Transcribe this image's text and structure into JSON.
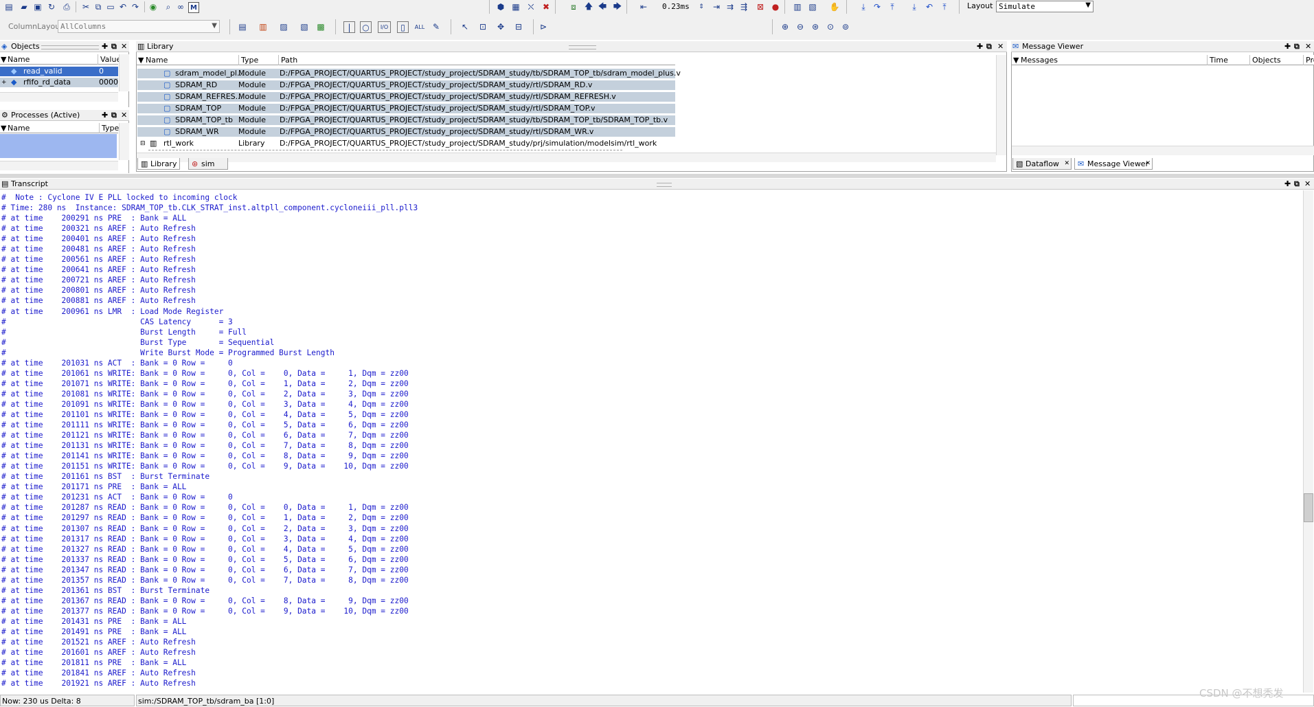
{
  "toolbar": {
    "time_value": "0.23ms",
    "layout_label": "Layout",
    "layout_value": "Simulate",
    "column_layout_label": "ColumnLayout",
    "column_layout_value": "AllColumns"
  },
  "objects": {
    "title": "Objects",
    "col_name": "Name",
    "col_value": "Value",
    "rows": [
      {
        "name": "read_valid",
        "value": "0"
      },
      {
        "name": "rfifo_rd_data",
        "value": "0000("
      }
    ]
  },
  "processes": {
    "title": "Processes (Active)",
    "col_name": "Name",
    "col_type": "Type"
  },
  "library": {
    "title": "Library",
    "col_name": "Name",
    "col_type": "Type",
    "col_path": "Path",
    "rows": [
      {
        "name": "sdram_model_pl...",
        "type": "Module",
        "path": "D:/FPGA_PROJECT/QUARTUS_PROJECT/study_project/SDRAM_study/tb/SDRAM_TOP_tb/sdram_model_plus.v"
      },
      {
        "name": "SDRAM_RD",
        "type": "Module",
        "path": "D:/FPGA_PROJECT/QUARTUS_PROJECT/study_project/SDRAM_study/rtl/SDRAM_RD.v"
      },
      {
        "name": "SDRAM_REFRES...",
        "type": "Module",
        "path": "D:/FPGA_PROJECT/QUARTUS_PROJECT/study_project/SDRAM_study/rtl/SDRAM_REFRESH.v"
      },
      {
        "name": "SDRAM_TOP",
        "type": "Module",
        "path": "D:/FPGA_PROJECT/QUARTUS_PROJECT/study_project/SDRAM_study/rtl/SDRAM_TOP.v"
      },
      {
        "name": "SDRAM_TOP_tb",
        "type": "Module",
        "path": "D:/FPGA_PROJECT/QUARTUS_PROJECT/study_project/SDRAM_study/tb/SDRAM_TOP_tb/SDRAM_TOP_tb.v"
      },
      {
        "name": "SDRAM_WR",
        "type": "Module",
        "path": "D:/FPGA_PROJECT/QUARTUS_PROJECT/study_project/SDRAM_study/rtl/SDRAM_WR.v"
      },
      {
        "name": "rtl_work",
        "type": "Library",
        "path": "D:/FPGA_PROJECT/QUARTUS_PROJECT/study_project/SDRAM_study/prj/simulation/modelsim/rtl_work"
      }
    ],
    "tabs": [
      "Library",
      "sim"
    ]
  },
  "messages": {
    "title": "Message Viewer",
    "col_messages": "Messages",
    "col_time": "Time",
    "col_objects": "Objects",
    "col_pro": "Pro",
    "tabs": [
      "Dataflow",
      "Message Viewer"
    ]
  },
  "transcript": {
    "title": "Transcript",
    "lines": [
      "#  Note : Cyclone IV E PLL locked to incoming clock",
      "# Time: 280 ns  Instance: SDRAM_TOP_tb.CLK_STRAT_inst.altpll_component.cycloneiii_pll.pll3",
      "# at time    200291 ns PRE  : Bank = ALL",
      "# at time    200321 ns AREF : Auto Refresh",
      "# at time    200401 ns AREF : Auto Refresh",
      "# at time    200481 ns AREF : Auto Refresh",
      "# at time    200561 ns AREF : Auto Refresh",
      "# at time    200641 ns AREF : Auto Refresh",
      "# at time    200721 ns AREF : Auto Refresh",
      "# at time    200801 ns AREF : Auto Refresh",
      "# at time    200881 ns AREF : Auto Refresh",
      "# at time    200961 ns LMR  : Load Mode Register",
      "#                             CAS Latency      = 3",
      "#                             Burst Length     = Full",
      "#                             Burst Type       = Sequential",
      "#                             Write Burst Mode = Programmed Burst Length",
      "# at time    201031 ns ACT  : Bank = 0 Row =     0",
      "# at time    201061 ns WRITE: Bank = 0 Row =     0, Col =    0, Data =     1, Dqm = zz00",
      "# at time    201071 ns WRITE: Bank = 0 Row =     0, Col =    1, Data =     2, Dqm = zz00",
      "# at time    201081 ns WRITE: Bank = 0 Row =     0, Col =    2, Data =     3, Dqm = zz00",
      "# at time    201091 ns WRITE: Bank = 0 Row =     0, Col =    3, Data =     4, Dqm = zz00",
      "# at time    201101 ns WRITE: Bank = 0 Row =     0, Col =    4, Data =     5, Dqm = zz00",
      "# at time    201111 ns WRITE: Bank = 0 Row =     0, Col =    5, Data =     6, Dqm = zz00",
      "# at time    201121 ns WRITE: Bank = 0 Row =     0, Col =    6, Data =     7, Dqm = zz00",
      "# at time    201131 ns WRITE: Bank = 0 Row =     0, Col =    7, Data =     8, Dqm = zz00",
      "# at time    201141 ns WRITE: Bank = 0 Row =     0, Col =    8, Data =     9, Dqm = zz00",
      "# at time    201151 ns WRITE: Bank = 0 Row =     0, Col =    9, Data =    10, Dqm = zz00",
      "# at time    201161 ns BST  : Burst Terminate",
      "# at time    201171 ns PRE  : Bank = ALL",
      "# at time    201231 ns ACT  : Bank = 0 Row =     0",
      "# at time    201287 ns READ : Bank = 0 Row =     0, Col =    0, Data =     1, Dqm = zz00",
      "# at time    201297 ns READ : Bank = 0 Row =     0, Col =    1, Data =     2, Dqm = zz00",
      "# at time    201307 ns READ : Bank = 0 Row =     0, Col =    2, Data =     3, Dqm = zz00",
      "# at time    201317 ns READ : Bank = 0 Row =     0, Col =    3, Data =     4, Dqm = zz00",
      "# at time    201327 ns READ : Bank = 0 Row =     0, Col =    4, Data =     5, Dqm = zz00",
      "# at time    201337 ns READ : Bank = 0 Row =     0, Col =    5, Data =     6, Dqm = zz00",
      "# at time    201347 ns READ : Bank = 0 Row =     0, Col =    6, Data =     7, Dqm = zz00",
      "# at time    201357 ns READ : Bank = 0 Row =     0, Col =    7, Data =     8, Dqm = zz00",
      "# at time    201361 ns BST  : Burst Terminate",
      "# at time    201367 ns READ : Bank = 0 Row =     0, Col =    8, Data =     9, Dqm = zz00",
      "# at time    201377 ns READ : Bank = 0 Row =     0, Col =    9, Data =    10, Dqm = zz00",
      "# at time    201431 ns PRE  : Bank = ALL",
      "# at time    201491 ns PRE  : Bank = ALL",
      "# at time    201521 ns AREF : Auto Refresh",
      "# at time    201601 ns AREF : Auto Refresh",
      "# at time    201811 ns PRE  : Bank = ALL",
      "# at time    201841 ns AREF : Auto Refresh",
      "# at time    201921 ns AREF : Auto Refresh"
    ]
  },
  "status": {
    "now": "Now: 230 us  Delta: 8",
    "path": "sim:/SDRAM_TOP_tb/sdram_ba [1:0]",
    "watermark": "CSDN @不想秃发"
  }
}
